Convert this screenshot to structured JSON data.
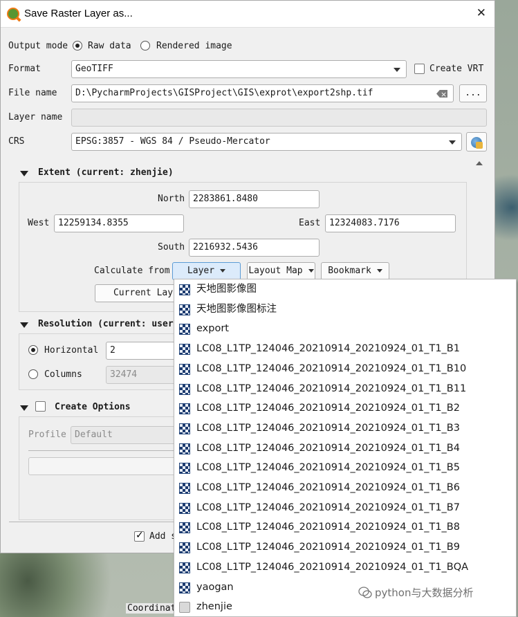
{
  "window": {
    "title": "Save Raster Layer as...",
    "close": "✕"
  },
  "output_mode": {
    "label": "Output mode",
    "options": [
      "Raw data",
      "Rendered image"
    ],
    "selected": "Raw data"
  },
  "format": {
    "label": "Format",
    "value": "GeoTIFF",
    "create_vrt_label": "Create VRT",
    "create_vrt_checked": false
  },
  "file_name": {
    "label": "File name",
    "value": "D:\\PycharmProjects\\GISProject\\GIS\\exprot\\export2shp.tif",
    "browse_label": "..."
  },
  "layer_name": {
    "label": "Layer name",
    "value": ""
  },
  "crs": {
    "label": "CRS",
    "value": "EPSG:3857 - WGS 84 / Pseudo-Mercator"
  },
  "extent": {
    "title": "Extent (current: zhenjie)",
    "north_label": "North",
    "north": "2283861.8480",
    "west_label": "West",
    "west": "12259134.8355",
    "east_label": "East",
    "east": "12324083.7176",
    "south_label": "South",
    "south": "2216932.5436",
    "calculate_from_label": "Calculate from",
    "layer_btn": "Layer",
    "layout_map_btn": "Layout Map",
    "bookmark_btn": "Bookmark",
    "current_layer_btn": "Current Lay"
  },
  "resolution": {
    "title": "Resolution (current: user",
    "horizontal_label": "Horizontal",
    "horizontal": "2",
    "columns_label": "Columns",
    "columns": "32474",
    "selected": "Horizontal"
  },
  "create_options": {
    "title": "Create Options",
    "checked": false,
    "profile_label": "Profile",
    "profile_value": "Default"
  },
  "add_label": "Add s",
  "menu_items": [
    {
      "label": "天地图影像图",
      "icon": "raster-icon"
    },
    {
      "label": "天地图影像图标注",
      "icon": "raster-icon"
    },
    {
      "label": "export",
      "icon": "raster-icon"
    },
    {
      "label": "LC08_L1TP_124046_20210914_20210924_01_T1_B1",
      "icon": "raster-icon"
    },
    {
      "label": "LC08_L1TP_124046_20210914_20210924_01_T1_B10",
      "icon": "raster-icon"
    },
    {
      "label": "LC08_L1TP_124046_20210914_20210924_01_T1_B11",
      "icon": "raster-icon"
    },
    {
      "label": "LC08_L1TP_124046_20210914_20210924_01_T1_B2",
      "icon": "raster-icon"
    },
    {
      "label": "LC08_L1TP_124046_20210914_20210924_01_T1_B3",
      "icon": "raster-icon"
    },
    {
      "label": "LC08_L1TP_124046_20210914_20210924_01_T1_B4",
      "icon": "raster-icon"
    },
    {
      "label": "LC08_L1TP_124046_20210914_20210924_01_T1_B5",
      "icon": "raster-icon"
    },
    {
      "label": "LC08_L1TP_124046_20210914_20210924_01_T1_B6",
      "icon": "raster-icon"
    },
    {
      "label": "LC08_L1TP_124046_20210914_20210924_01_T1_B7",
      "icon": "raster-icon"
    },
    {
      "label": "LC08_L1TP_124046_20210914_20210924_01_T1_B8",
      "icon": "raster-icon"
    },
    {
      "label": "LC08_L1TP_124046_20210914_20210924_01_T1_B9",
      "icon": "raster-icon"
    },
    {
      "label": "LC08_L1TP_124046_20210914_20210924_01_T1_BQA",
      "icon": "raster-icon"
    },
    {
      "label": "yaogan",
      "icon": "raster-icon"
    },
    {
      "label": "zhenjie",
      "icon": "mesh-icon"
    }
  ],
  "status_bar": {
    "coordinate_label": "Coordinate"
  },
  "watermark": "python与大数据分析"
}
